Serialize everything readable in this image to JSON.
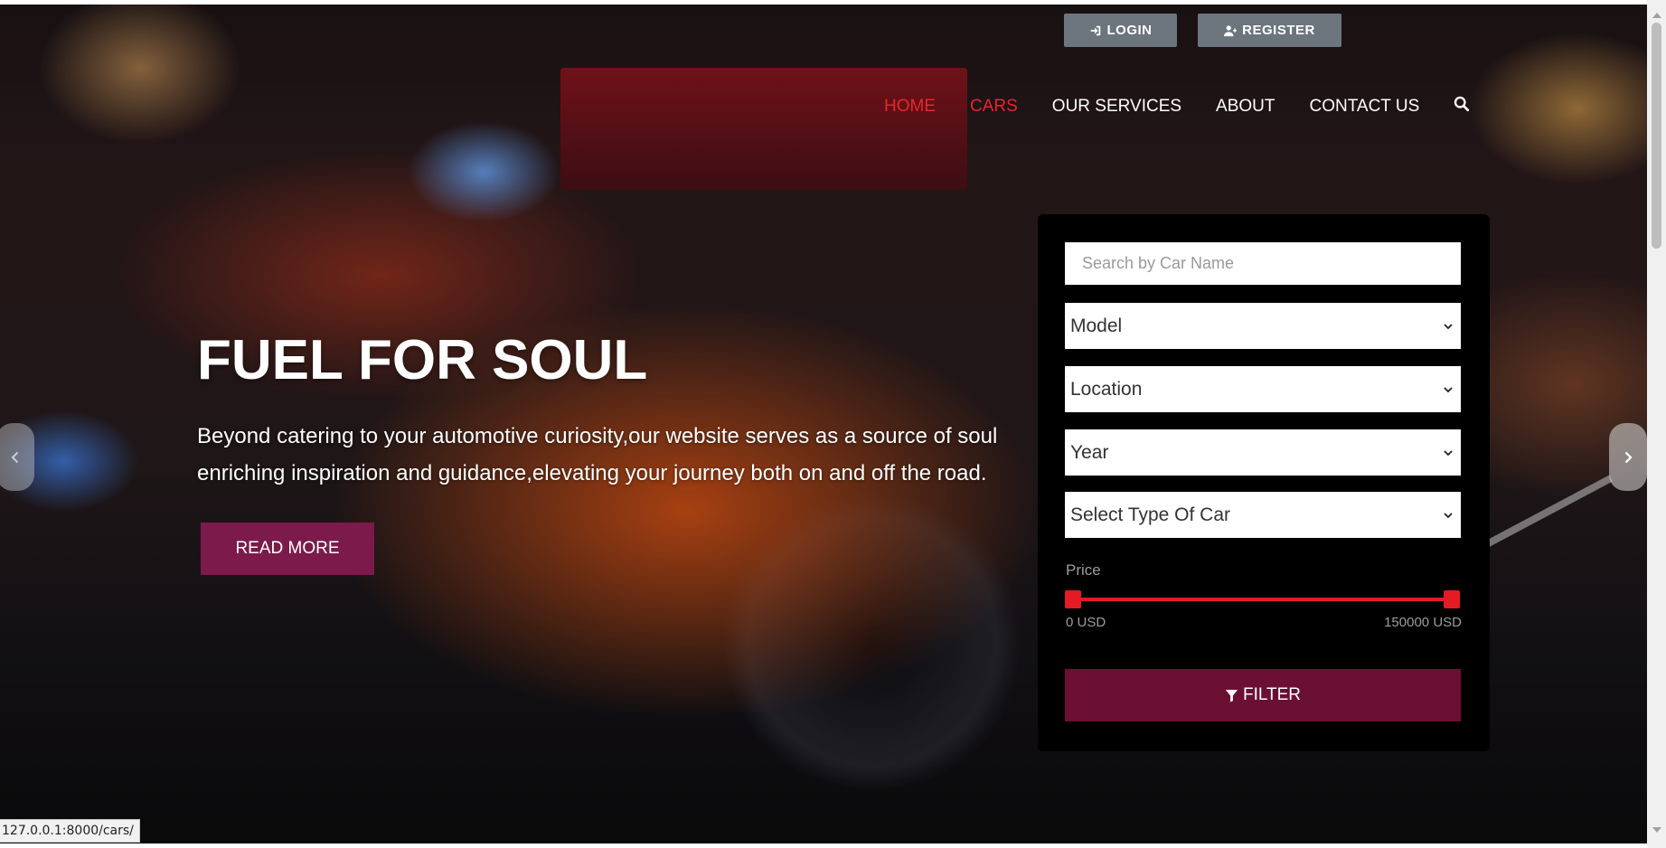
{
  "auth": {
    "login_label": "LOGIN",
    "register_label": "REGISTER"
  },
  "nav": {
    "items": [
      {
        "label": "HOME",
        "active": true
      },
      {
        "label": "CARS",
        "active": true
      },
      {
        "label": "OUR SERVICES",
        "active": false
      },
      {
        "label": "ABOUT",
        "active": false
      },
      {
        "label": "CONTACT US",
        "active": false
      }
    ],
    "search_icon": "search-icon",
    "active_color": "#e8262b"
  },
  "hero": {
    "title": "FUEL FOR SOUL",
    "description": "Beyond catering to your automotive curiosity,our website serves as a source of soul enriching inspiration and guidance,elevating your journey both on and off the road.",
    "read_more_label": "READ MORE",
    "button_color": "#7b1a4b"
  },
  "search": {
    "placeholder": "Search by Car Name",
    "selects": {
      "model": "Model",
      "location": "Location",
      "year": "Year",
      "type": "Select Type Of Car"
    },
    "price": {
      "label": "Price",
      "min_label": "0 USD",
      "max_label": "150000 USD",
      "min": 0,
      "max": 150000,
      "selected_min_fraction": 0.0,
      "selected_max_fraction": 1.0,
      "track_color": "#e41b23"
    },
    "filter_label": "FILTER",
    "filter_color": "#6c1033"
  },
  "status": {
    "url": "127.0.0.1:8000/cars/"
  }
}
